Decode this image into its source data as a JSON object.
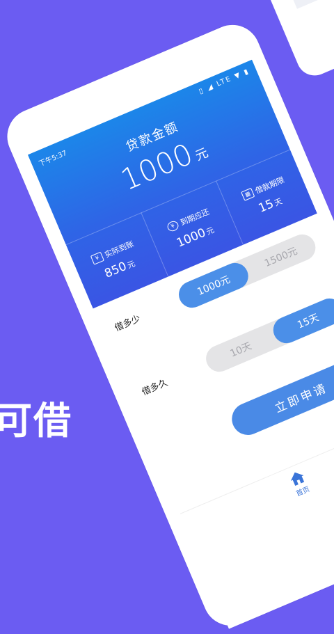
{
  "promo": {
    "text": "可借"
  },
  "status": {
    "time": "下午5:37",
    "network": "LTE"
  },
  "loan": {
    "title": "贷款金额",
    "amount": "1000",
    "amount_unit": "元",
    "stats": [
      {
        "label": "实际到账",
        "value": "850",
        "unit": "元",
        "icon": "wallet-icon"
      },
      {
        "label": "到期应还",
        "value": "1000",
        "unit": "元",
        "icon": "yen-clock-icon"
      },
      {
        "label": "借款期限",
        "value": "15",
        "unit": "天",
        "icon": "calendar-icon"
      }
    ]
  },
  "amount_select": {
    "label": "借多少",
    "options": [
      "1000元",
      "1500元"
    ],
    "selected": 0
  },
  "term_select": {
    "label": "借多久",
    "options": [
      "10天",
      "15天"
    ],
    "selected": 1
  },
  "apply_button": {
    "label": "立即申请"
  },
  "tabbar": {
    "home_label": "首页"
  },
  "colors": {
    "background": "#6b5cf2",
    "accent": "#4a8ae6",
    "hero_top": "#1c86e9",
    "hero_bottom": "#3a55e4"
  }
}
